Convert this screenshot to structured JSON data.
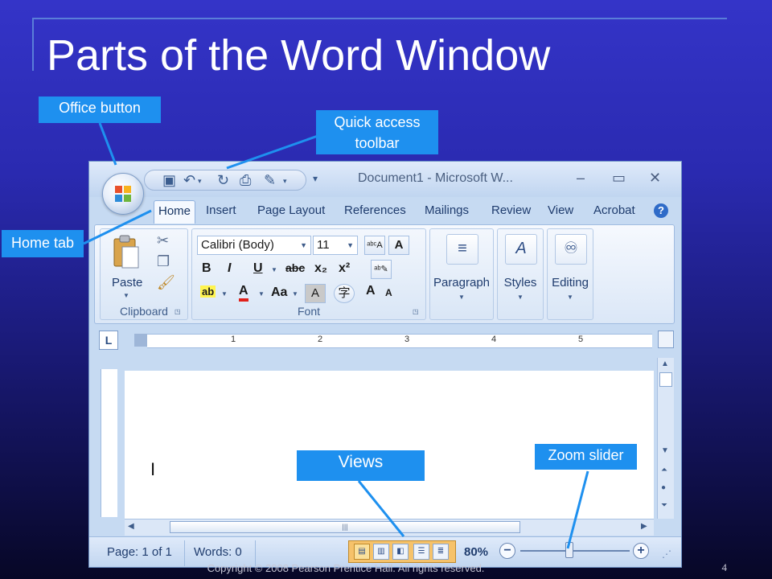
{
  "slide": {
    "title": "Parts of the Word Window",
    "footer": "Copyright © 2008 Pearson Prentice Hall. All rights reserved.",
    "page_number": "4",
    "colors": {
      "background": "#2a2ab0",
      "callout": "#1e90ef",
      "leader": "#1e90ef"
    }
  },
  "callouts": {
    "office_button": "Office button",
    "quick_access_line1": "Quick access",
    "quick_access_line2": "toolbar",
    "home_tab": "Home tab",
    "views": "Views",
    "zoom_slider": "Zoom slider"
  },
  "word": {
    "window_title": "Document1 - Microsoft W...",
    "window_controls": {
      "minimize": "–",
      "restore": "▭",
      "close": "✕"
    },
    "qat_icons": [
      "save-icon",
      "undo-icon",
      "redo-icon",
      "print-icon",
      "customize-icon"
    ],
    "tabs": [
      "Home",
      "Insert",
      "Page Layout",
      "References",
      "Mailings",
      "Review",
      "View",
      "Acrobat"
    ],
    "active_tab": "Home",
    "help_label": "?",
    "ribbon": {
      "clipboard": {
        "label": "Clipboard",
        "paste": "Paste"
      },
      "font": {
        "label": "Font",
        "font_name": "Calibri (Body)",
        "font_size": "11",
        "bold": "B",
        "italic": "I",
        "underline": "U",
        "strikethrough": "abc",
        "subscript": "x₂",
        "superscript": "x²",
        "change_case": "Aa",
        "grow_font": "A",
        "shrink_font": "A"
      },
      "paragraph": {
        "label": "Paragraph"
      },
      "styles": {
        "label": "Styles"
      },
      "editing": {
        "label": "Editing"
      }
    },
    "ruler_numbers": [
      "1",
      "2",
      "3",
      "4",
      "5"
    ],
    "status": {
      "page": "Page: 1 of 1",
      "words": "Words: 0",
      "zoom": "80%",
      "zoom_level": 0.45
    }
  }
}
